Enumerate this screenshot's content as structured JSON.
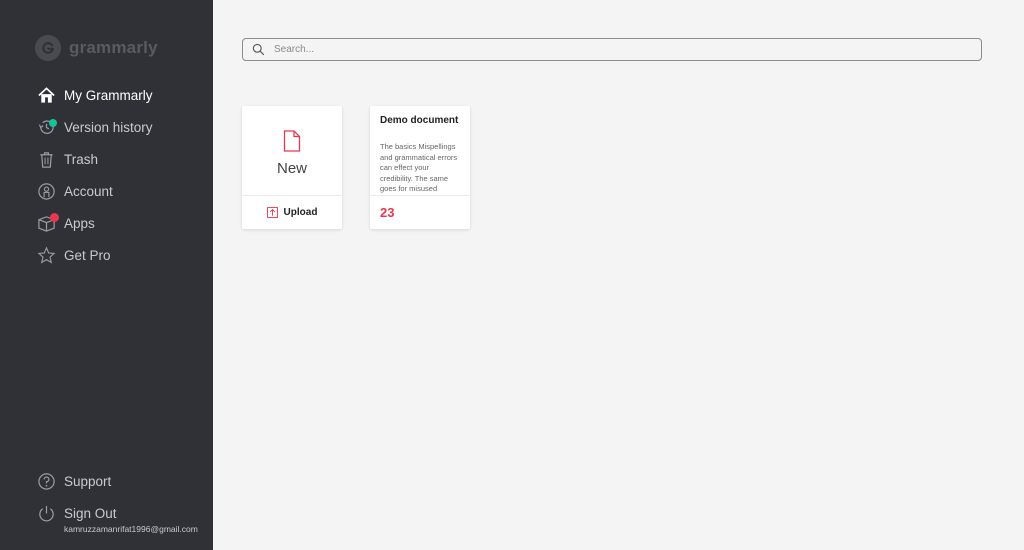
{
  "brand": {
    "name": "grammarly",
    "icon": "grammarly-logo-icon"
  },
  "sidebar": {
    "items": [
      {
        "label": "My Grammarly",
        "icon": "home-icon",
        "active": true
      },
      {
        "label": "Version history",
        "icon": "history-icon"
      },
      {
        "label": "Trash",
        "icon": "trash-icon"
      },
      {
        "label": "Account",
        "icon": "account-icon"
      },
      {
        "label": "Apps",
        "icon": "apps-icon"
      },
      {
        "label": "Get Pro",
        "icon": "star-icon"
      }
    ],
    "bottom": [
      {
        "label": "Support",
        "icon": "help-icon"
      },
      {
        "label": "Sign Out",
        "icon": "power-icon"
      }
    ],
    "email": "kamruzzamanrifat1996@gmail.com"
  },
  "search": {
    "placeholder": "Search...",
    "value": ""
  },
  "cards": {
    "new": {
      "label": "New",
      "upload_label": "Upload"
    },
    "document": {
      "title": "Demo document",
      "preview": "The basics Mispellings and grammatical errors can effect your credibility. The same goes for misused commas, and other types of punctuation.",
      "score": "23"
    }
  },
  "colors": {
    "sidebar_bg": "#303136",
    "accent_red": "#e8384f",
    "badge_teal": "#15c39a",
    "badge_red": "#e8384f"
  }
}
